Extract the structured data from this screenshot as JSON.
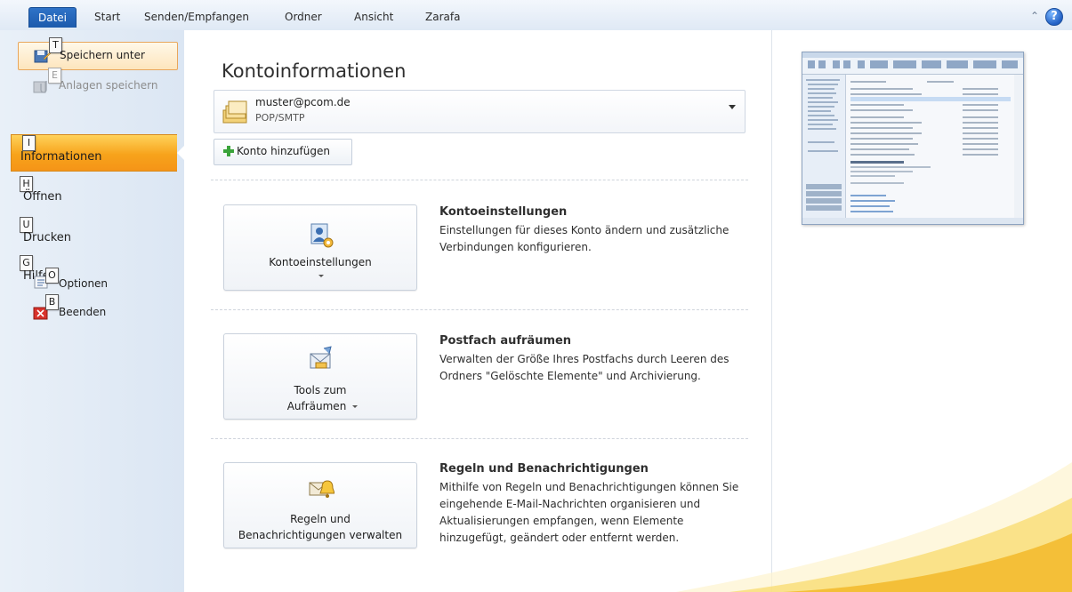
{
  "ribbon": {
    "tabs": [
      "Datei",
      "Start",
      "Senden/Empfangen",
      "Ordner",
      "Ansicht",
      "Zarafa"
    ],
    "help_label": "?"
  },
  "backstage": {
    "commands": [
      {
        "label": "Speichern unter",
        "keytip": "T",
        "icon": "save-as-icon"
      },
      {
        "label": "Anlagen speichern",
        "keytip": "E",
        "icon": "save-attachments-icon"
      }
    ],
    "tabs": [
      {
        "label": "Informationen",
        "keytip": "I"
      },
      {
        "label": "Öffnen",
        "keytip": "H"
      },
      {
        "label": "Drucken",
        "keytip": "U"
      },
      {
        "label": "Hilfe",
        "keytip": "G"
      }
    ],
    "bottom_commands": [
      {
        "label": "Optionen",
        "keytip": "O",
        "icon": "options-icon"
      },
      {
        "label": "Beenden",
        "keytip": "B",
        "icon": "exit-icon"
      }
    ]
  },
  "main": {
    "title": "Kontoinformationen",
    "account": {
      "email": "muster@pcom.de",
      "type": "POP/SMTP"
    },
    "add_account_label": "Konto hinzufügen",
    "sections": [
      {
        "button_label_1": "Kontoeinstellungen",
        "button_label_2": "",
        "title": "Kontoeinstellungen",
        "description": "Einstellungen für dieses Konto ändern und zusätzliche Verbindungen konfigurieren.",
        "icon": "account-settings-icon"
      },
      {
        "button_label_1": "Tools zum",
        "button_label_2": "Aufräumen",
        "title": "Postfach aufräumen",
        "description": "Verwalten der Größe Ihres Postfachs durch Leeren des Ordners \"Gelöschte Elemente\" und Archivierung.",
        "icon": "cleanup-tools-icon"
      },
      {
        "button_label_1": "Regeln und",
        "button_label_2": "Benachrichtigungen verwalten",
        "title": "Regeln und Benachrichtigungen",
        "description": "Mithilfe von Regeln und Benachrichtigungen können Sie eingehende E-Mail-Nachrichten organisieren und Aktualisierungen empfangen, wenn Elemente hinzugefügt, geändert oder entfernt werden.",
        "icon": "rules-alerts-icon"
      }
    ]
  },
  "colors": {
    "file_tab": "#2266b8",
    "selected_nav": "#f7a31b",
    "accent_swoosh": "#f6c12c"
  }
}
